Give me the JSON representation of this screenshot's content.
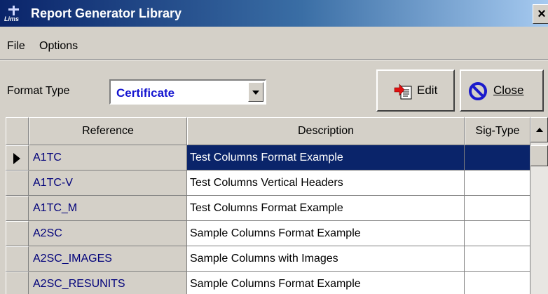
{
  "window": {
    "title": "Report Generator Library",
    "icon_text": "Lims",
    "close_glyph": "×"
  },
  "menu": {
    "items": [
      "File",
      "Options"
    ]
  },
  "toolbar": {
    "format_label": "Format Type",
    "format_value": "Certificate",
    "edit_label": "Edit",
    "close_label": "Close"
  },
  "grid": {
    "columns": [
      "Reference",
      "Description",
      "Sig-Type"
    ],
    "rows": [
      {
        "reference": "A1TC",
        "description": "Test Columns Format Example",
        "sig_type": "",
        "selected": true
      },
      {
        "reference": "A1TC-V",
        "description": "Test Columns Vertical Headers",
        "sig_type": ""
      },
      {
        "reference": "A1TC_M",
        "description": "Test Columns Format Example",
        "sig_type": ""
      },
      {
        "reference": "A2SC",
        "description": "Sample Columns Format Example",
        "sig_type": ""
      },
      {
        "reference": "A2SC_IMAGES",
        "description": "Sample Columns with Images",
        "sig_type": ""
      },
      {
        "reference": "A2SC_RESUNITS",
        "description": "Sample Columns Format Example",
        "sig_type": ""
      }
    ]
  },
  "colors": {
    "title_gradient_start": "#0a246a",
    "title_gradient_end": "#a6caf0",
    "selection": "#0a246a",
    "format_value": "#1414d0",
    "window_face": "#d4d0c8"
  },
  "icons": [
    "app-icon",
    "close-icon",
    "edit-document-icon",
    "prohibit-icon",
    "dropdown-arrow-icon",
    "row-indicator-icon",
    "scroll-up-icon"
  ]
}
